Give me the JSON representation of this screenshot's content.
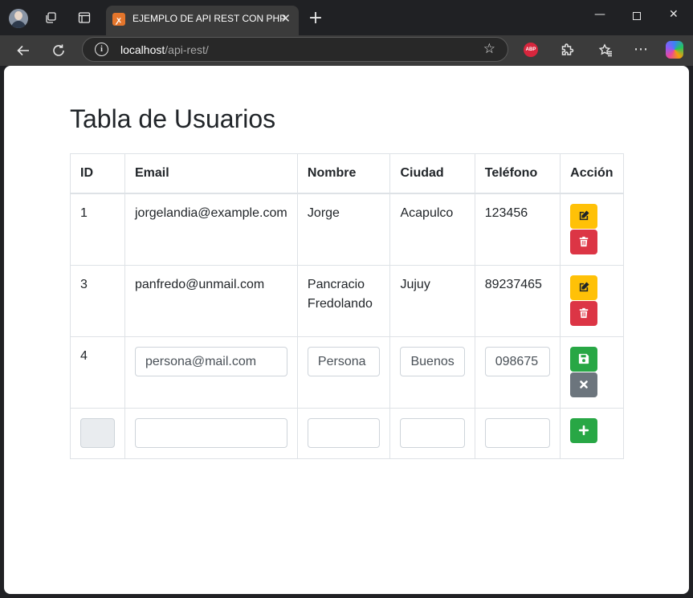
{
  "browser": {
    "tab_title": "EJEMPLO DE API REST CON PHP",
    "tab_favicon": "xampp-icon",
    "url_host": "localhost",
    "url_path": "/api-rest/",
    "extension_abp": "ABP"
  },
  "page": {
    "title": "Tabla de Usuarios",
    "columns": [
      "ID",
      "Email",
      "Nombre",
      "Ciudad",
      "Teléfono",
      "Acción"
    ],
    "rows": [
      {
        "id": "1",
        "email": "jorgelandia@example.com",
        "nombre": "Jorge",
        "ciudad": "Acapulco",
        "telefono": "123456",
        "actions": [
          "edit",
          "delete"
        ]
      },
      {
        "id": "3",
        "email": "panfredo@unmail.com",
        "nombre": "Pancracio Fredolando",
        "ciudad": "Jujuy",
        "telefono": "89237465",
        "actions": [
          "edit",
          "delete"
        ]
      }
    ],
    "edit_row": {
      "id": "4",
      "email": "persona@mail.com",
      "nombre": "Persona",
      "ciudad": "Buenos",
      "telefono": "098675",
      "actions": [
        "save",
        "cancel"
      ]
    },
    "new_row": {
      "id": "",
      "email": "",
      "nombre": "",
      "ciudad": "",
      "telefono": "",
      "actions": [
        "add"
      ]
    }
  },
  "colors": {
    "warning": "#ffc107",
    "danger": "#dc3545",
    "success": "#28a745",
    "secondary": "#6c757d"
  }
}
